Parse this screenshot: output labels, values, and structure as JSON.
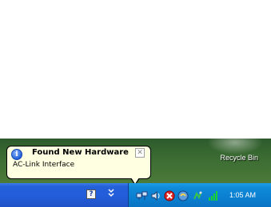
{
  "balloon": {
    "title": "Found New Hardware",
    "message": "AC-Link Interface",
    "close_glyph": "✕",
    "icon": "info-icon"
  },
  "desktop": {
    "recycle_bin_label": "Recycle Bin"
  },
  "quicklaunch": {
    "help_glyph": "?",
    "more_icon": "chevron-double-down-icon"
  },
  "tray": {
    "icons": [
      "network-icon",
      "sound-icon",
      "security-alert-icon",
      "update-icon",
      "hardware-icon",
      "signal-bars-icon"
    ],
    "clock": "1:05 AM"
  }
}
